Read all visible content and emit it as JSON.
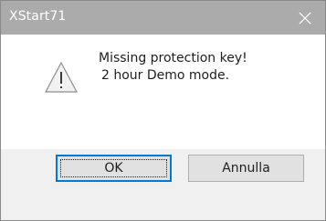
{
  "window": {
    "title": "XStart71",
    "close_label": "×"
  },
  "message": {
    "line1": "Missing protection key!",
    "line2": "2 hour Demo mode."
  },
  "buttons": {
    "ok_label": "OK",
    "cancel_label": "Annulla"
  },
  "icons": {
    "warning": "warning-triangle-icon",
    "close": "close-icon"
  },
  "colors": {
    "titlebar": "#ababab",
    "footer": "#f0f0f0",
    "focus_border": "#0078d7"
  }
}
